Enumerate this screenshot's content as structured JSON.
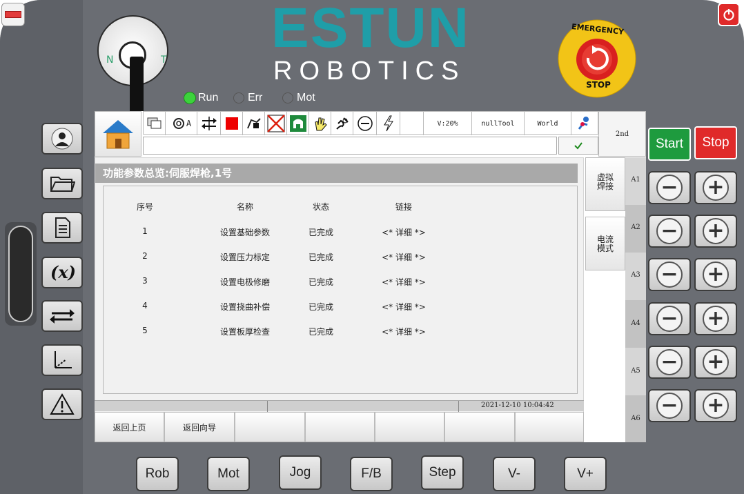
{
  "brand": {
    "logo": "ESTUN",
    "sub": "ROBOTICS"
  },
  "key_switch": {
    "left": "N",
    "right": "T"
  },
  "status_leds": [
    {
      "label": "Run",
      "color": "#3cd33c"
    },
    {
      "label": "Err",
      "color": "#6d7076"
    },
    {
      "label": "Mot",
      "color": "#6d7076"
    }
  ],
  "estop": {
    "top": "EMERGENCY",
    "bottom": "STOP"
  },
  "toolbar": {
    "velocity": "V:20%",
    "tool": "nullTool",
    "frame": "World",
    "second": "2nd",
    "auto_label": "A"
  },
  "start_label": "Start",
  "stop_label": "Stop",
  "main": {
    "title": "功能参数总览:伺服焊枪,1号",
    "headers": [
      "序号",
      "名称",
      "状态",
      "链接"
    ],
    "rows": [
      {
        "no": "1",
        "name": "设置基础参数",
        "state": "已完成",
        "link": "<* 详细 *>"
      },
      {
        "no": "2",
        "name": "设置压力标定",
        "state": "已完成",
        "link": "<* 详细 *>"
      },
      {
        "no": "3",
        "name": "设置电极修磨",
        "state": "已完成",
        "link": "<* 详细 *>"
      },
      {
        "no": "4",
        "name": "设置挠曲补偿",
        "state": "已完成",
        "link": "<* 详细 *>"
      },
      {
        "no": "5",
        "name": "设置板厚检查",
        "state": "已完成",
        "link": "<* 详细 *>"
      }
    ]
  },
  "side_tabs": {
    "tab1": "虚拟\n焊接",
    "tab2": "电流\n模式"
  },
  "axes": [
    "A1",
    "A2",
    "A3",
    "A4",
    "A5",
    "A6"
  ],
  "datetime": "2021-12-10 10:04:42",
  "footer_buttons": [
    "返回上页",
    "返回向导",
    "",
    "",
    "",
    "",
    ""
  ],
  "bottom_keys": [
    "Rob",
    "Mot",
    "Jog",
    "F/B",
    "Step",
    "V-",
    "V+"
  ],
  "colors": {
    "brand": "#1f9ea8",
    "start": "#1e9b3e",
    "stop": "#e02a2a",
    "body": "#6a6d73"
  }
}
